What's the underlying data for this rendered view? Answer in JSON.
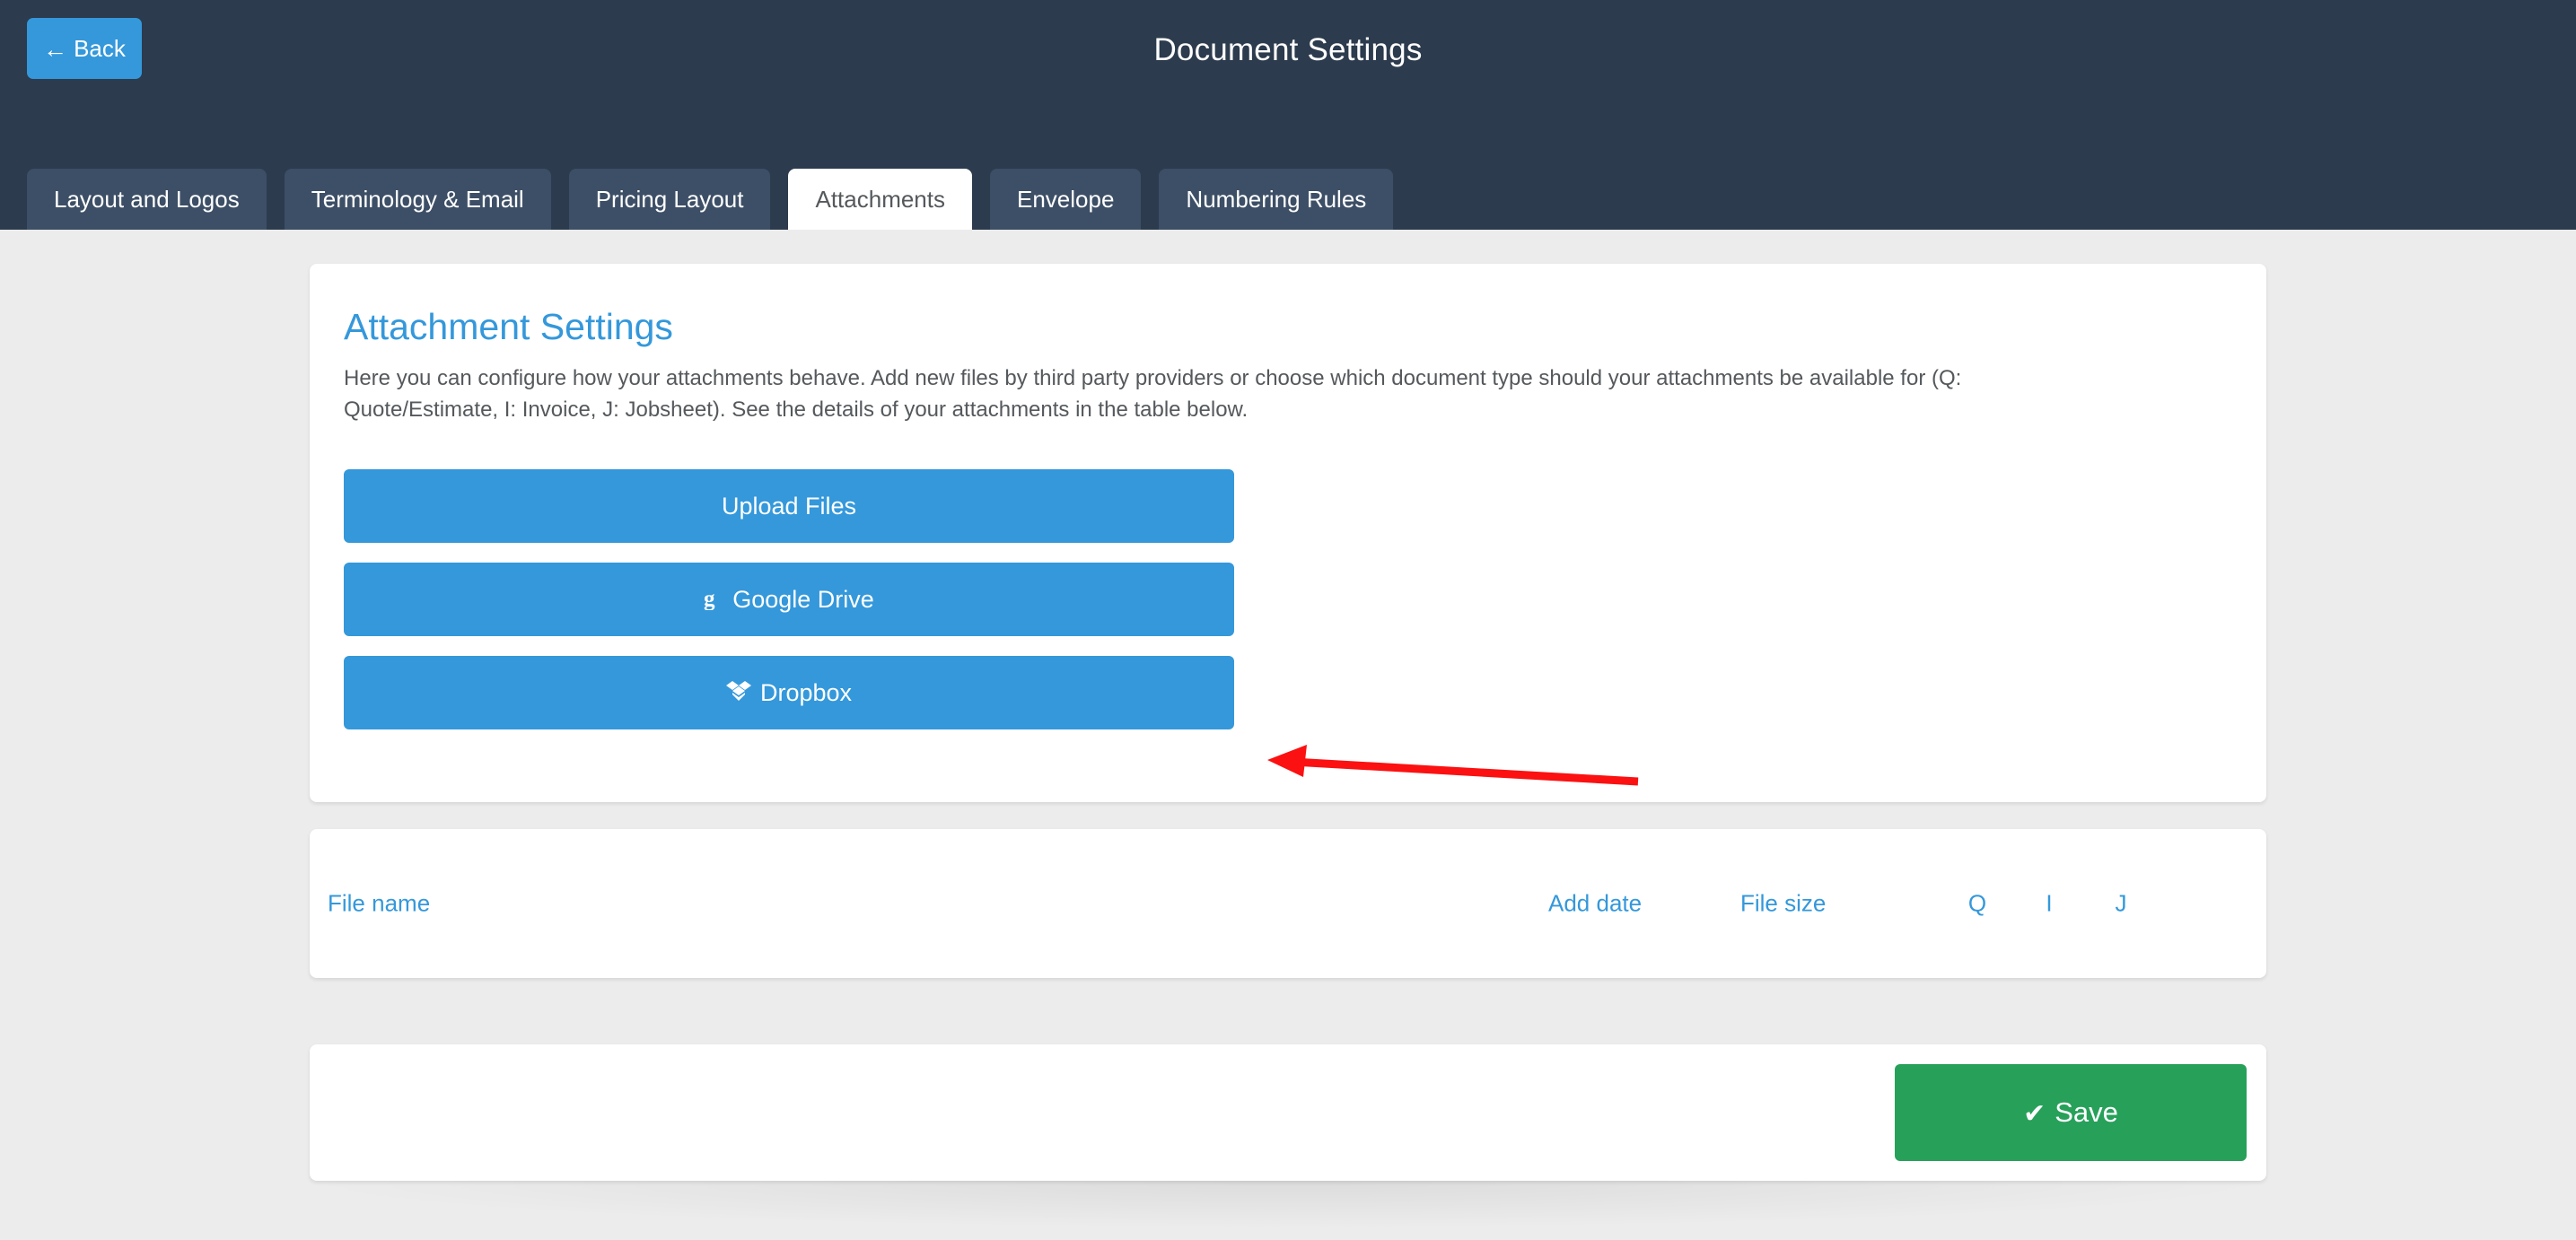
{
  "header": {
    "title": "Document Settings",
    "back_label": "Back",
    "back_icon": "arrow-left-icon",
    "back_arrow_glyph": "←",
    "bg_color": "#2c3b4d",
    "accent_color": "#3498db"
  },
  "tabs": [
    {
      "label": "Layout and Logos",
      "active": false
    },
    {
      "label": "Terminology & Email",
      "active": false
    },
    {
      "label": "Pricing Layout",
      "active": false
    },
    {
      "label": "Attachments",
      "active": true
    },
    {
      "label": "Envelope",
      "active": false
    },
    {
      "label": "Numbering Rules",
      "active": false
    }
  ],
  "settings_card": {
    "title": "Attachment Settings",
    "description": "Here you can configure how your attachments behave. Add new files by third party providers or choose which document type should your attachments be available for (Q: Quote/Estimate, I: Invoice, J: Jobsheet). See the details of your attachments in the table below.",
    "title_color": "#3498db",
    "buttons": [
      {
        "label": "Upload Files",
        "icon": null,
        "glyph": ""
      },
      {
        "label": "Google Drive",
        "icon": "google-drive-icon",
        "glyph": "ɢ"
      },
      {
        "label": "Dropbox",
        "icon": "dropbox-icon",
        "glyph": "❖"
      }
    ],
    "button_color": "#3498db"
  },
  "attachments_table": {
    "columns": [
      {
        "key": "file_name",
        "label": "File name"
      },
      {
        "key": "add_date",
        "label": "Add date"
      },
      {
        "key": "file_size",
        "label": "File size"
      },
      {
        "key": "q",
        "label": "Q"
      },
      {
        "key": "i",
        "label": "I"
      },
      {
        "key": "j",
        "label": "J"
      }
    ],
    "rows": [],
    "header_color": "#3498db"
  },
  "footer": {
    "save_label": "Save",
    "save_icon": "check-icon",
    "save_glyph": "✔",
    "save_color": "#27a05a"
  },
  "annotation": {
    "type": "arrow",
    "color": "#fb1111",
    "points_to": "Upload Files"
  }
}
